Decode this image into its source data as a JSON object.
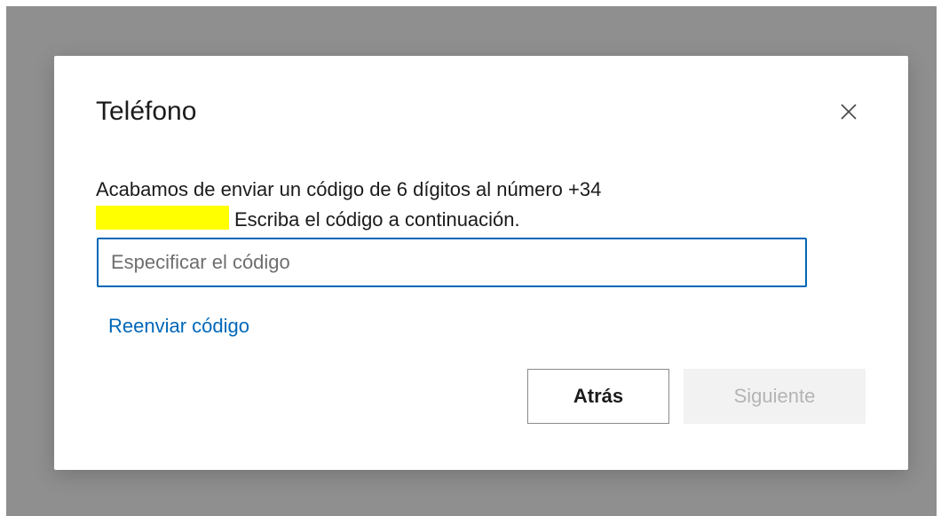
{
  "dialog": {
    "title": "Teléfono",
    "description_line1": "Acabamos de enviar un código de 6 dígitos al número +34",
    "description_line2": "Escriba el código a continuación.",
    "code_input": {
      "value": "",
      "placeholder": "Especificar el código"
    },
    "resend_link": "Reenviar código",
    "back_button": "Atrás",
    "next_button": "Siguiente",
    "close_icon": "close-icon"
  },
  "colors": {
    "accent": "#0067b8",
    "redaction": "#ffff00",
    "backdrop": "#8f8f8f",
    "disabled_bg": "#f2f2f2",
    "disabled_text": "#b4b4b4"
  }
}
